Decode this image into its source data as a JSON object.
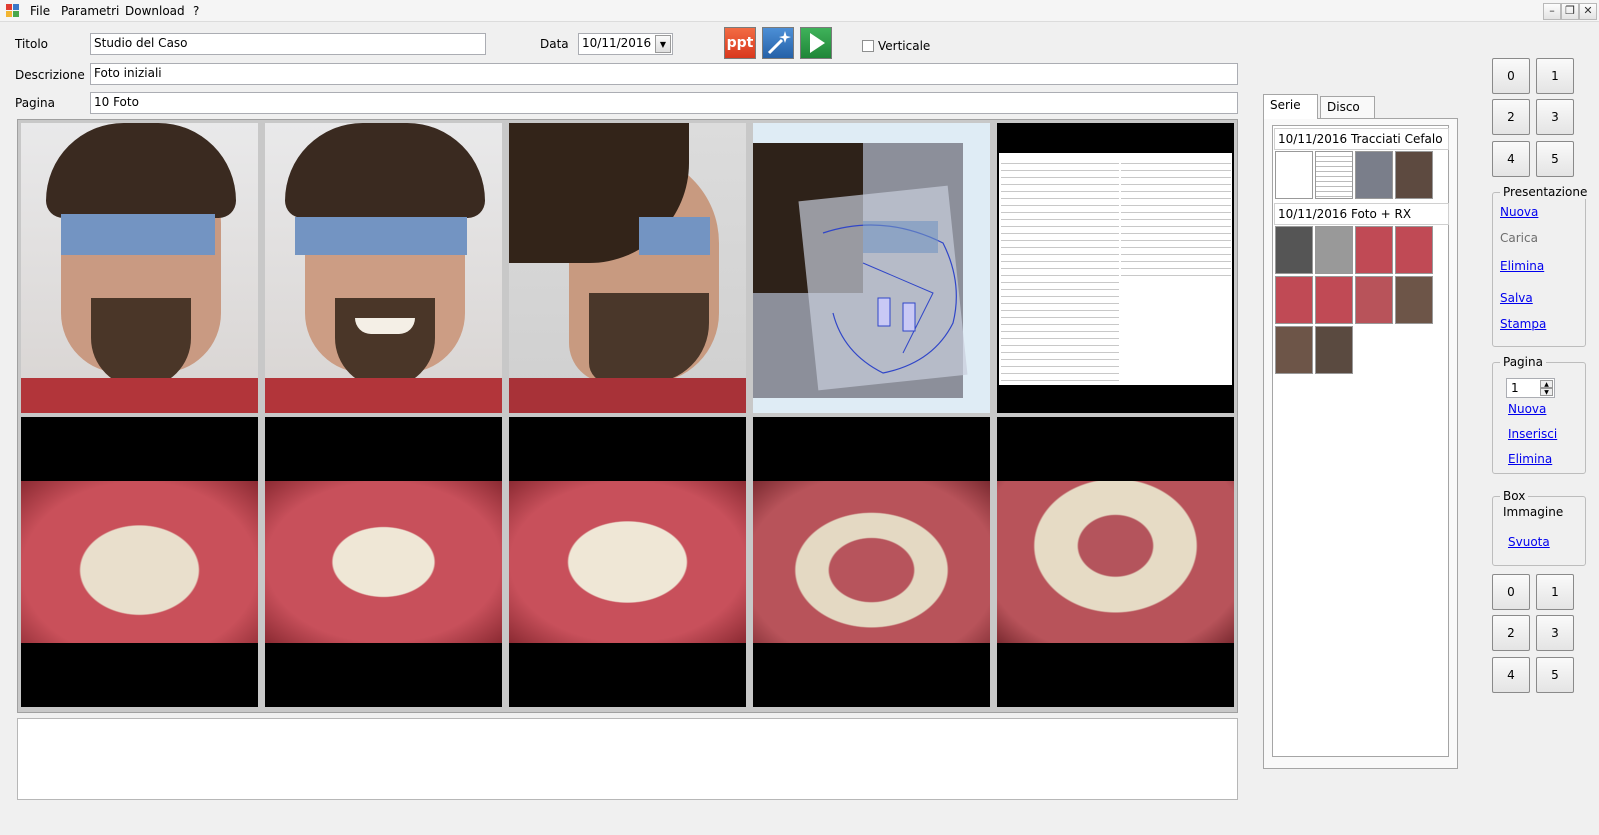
{
  "menu": {
    "items": [
      "File",
      "Parametri",
      "Download",
      "?"
    ]
  },
  "window_controls": {
    "minimize": "–",
    "restore": "❐",
    "close": "✕"
  },
  "form": {
    "titolo_label": "Titolo",
    "titolo_value": "Studio del Caso",
    "data_label": "Data",
    "data_value": "10/11/2016",
    "descrizione_label": "Descrizione",
    "descrizione_value": "Foto iniziali",
    "pagina_label": "Pagina",
    "pagina_value": "10 Foto",
    "verticale_label": "Verticale",
    "verticale_checked": false
  },
  "toolbar": {
    "ppt_label": "ppt"
  },
  "grid": {
    "photos": [
      {
        "name": "face-frontal-photo"
      },
      {
        "name": "face-smile-photo"
      },
      {
        "name": "face-profile-photo"
      },
      {
        "name": "cephalometric-tracing-photo"
      },
      {
        "name": "cephalometric-analysis-table"
      },
      {
        "name": "intraoral-right-photo"
      },
      {
        "name": "intraoral-frontal-photo"
      },
      {
        "name": "intraoral-left-photo"
      },
      {
        "name": "occlusal-upper-photo"
      },
      {
        "name": "occlusal-lower-photo"
      }
    ]
  },
  "tabs": {
    "serie": "Serie",
    "disco": "Disco"
  },
  "series": [
    {
      "title": "10/11/2016 Tracciati Cefalo",
      "thumb_count": 4
    },
    {
      "title": "10/11/2016 Foto + RX",
      "thumb_count": 10
    }
  ],
  "numbers_top": [
    "0",
    "1",
    "2",
    "3",
    "4",
    "5"
  ],
  "numbers_bottom": [
    "0",
    "1",
    "2",
    "3",
    "4",
    "5"
  ],
  "presentazione": {
    "title": "Presentazione",
    "nuova": "Nuova",
    "carica": "Carica",
    "elimina": "Elimina",
    "salva": "Salva",
    "stampa": "Stampa"
  },
  "pagina": {
    "title": "Pagina",
    "value": "1",
    "nuova": "Nuova",
    "inserisci": "Inserisci",
    "elimina": "Elimina"
  },
  "box_immagine": {
    "title_line1": "Box",
    "title_line2": "Immagine",
    "svuota": "Svuota"
  },
  "colors": {
    "privacy_bar": "#7394c2",
    "link": "#0000ee"
  }
}
